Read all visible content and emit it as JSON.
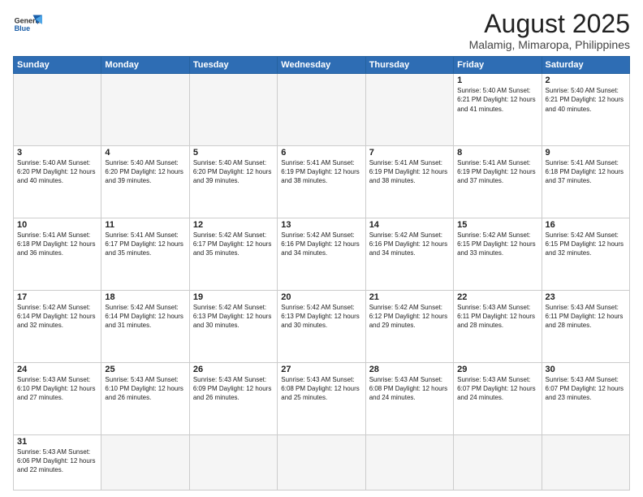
{
  "header": {
    "logo_general": "General",
    "logo_blue": "Blue",
    "title": "August 2025",
    "subtitle": "Malamig, Mimaropa, Philippines"
  },
  "weekdays": [
    "Sunday",
    "Monday",
    "Tuesday",
    "Wednesday",
    "Thursday",
    "Friday",
    "Saturday"
  ],
  "weeks": [
    [
      {
        "day": "",
        "info": ""
      },
      {
        "day": "",
        "info": ""
      },
      {
        "day": "",
        "info": ""
      },
      {
        "day": "",
        "info": ""
      },
      {
        "day": "",
        "info": ""
      },
      {
        "day": "1",
        "info": "Sunrise: 5:40 AM\nSunset: 6:21 PM\nDaylight: 12 hours\nand 41 minutes."
      },
      {
        "day": "2",
        "info": "Sunrise: 5:40 AM\nSunset: 6:21 PM\nDaylight: 12 hours\nand 40 minutes."
      }
    ],
    [
      {
        "day": "3",
        "info": "Sunrise: 5:40 AM\nSunset: 6:20 PM\nDaylight: 12 hours\nand 40 minutes."
      },
      {
        "day": "4",
        "info": "Sunrise: 5:40 AM\nSunset: 6:20 PM\nDaylight: 12 hours\nand 39 minutes."
      },
      {
        "day": "5",
        "info": "Sunrise: 5:40 AM\nSunset: 6:20 PM\nDaylight: 12 hours\nand 39 minutes."
      },
      {
        "day": "6",
        "info": "Sunrise: 5:41 AM\nSunset: 6:19 PM\nDaylight: 12 hours\nand 38 minutes."
      },
      {
        "day": "7",
        "info": "Sunrise: 5:41 AM\nSunset: 6:19 PM\nDaylight: 12 hours\nand 38 minutes."
      },
      {
        "day": "8",
        "info": "Sunrise: 5:41 AM\nSunset: 6:19 PM\nDaylight: 12 hours\nand 37 minutes."
      },
      {
        "day": "9",
        "info": "Sunrise: 5:41 AM\nSunset: 6:18 PM\nDaylight: 12 hours\nand 37 minutes."
      }
    ],
    [
      {
        "day": "10",
        "info": "Sunrise: 5:41 AM\nSunset: 6:18 PM\nDaylight: 12 hours\nand 36 minutes."
      },
      {
        "day": "11",
        "info": "Sunrise: 5:41 AM\nSunset: 6:17 PM\nDaylight: 12 hours\nand 35 minutes."
      },
      {
        "day": "12",
        "info": "Sunrise: 5:42 AM\nSunset: 6:17 PM\nDaylight: 12 hours\nand 35 minutes."
      },
      {
        "day": "13",
        "info": "Sunrise: 5:42 AM\nSunset: 6:16 PM\nDaylight: 12 hours\nand 34 minutes."
      },
      {
        "day": "14",
        "info": "Sunrise: 5:42 AM\nSunset: 6:16 PM\nDaylight: 12 hours\nand 34 minutes."
      },
      {
        "day": "15",
        "info": "Sunrise: 5:42 AM\nSunset: 6:15 PM\nDaylight: 12 hours\nand 33 minutes."
      },
      {
        "day": "16",
        "info": "Sunrise: 5:42 AM\nSunset: 6:15 PM\nDaylight: 12 hours\nand 32 minutes."
      }
    ],
    [
      {
        "day": "17",
        "info": "Sunrise: 5:42 AM\nSunset: 6:14 PM\nDaylight: 12 hours\nand 32 minutes."
      },
      {
        "day": "18",
        "info": "Sunrise: 5:42 AM\nSunset: 6:14 PM\nDaylight: 12 hours\nand 31 minutes."
      },
      {
        "day": "19",
        "info": "Sunrise: 5:42 AM\nSunset: 6:13 PM\nDaylight: 12 hours\nand 30 minutes."
      },
      {
        "day": "20",
        "info": "Sunrise: 5:42 AM\nSunset: 6:13 PM\nDaylight: 12 hours\nand 30 minutes."
      },
      {
        "day": "21",
        "info": "Sunrise: 5:42 AM\nSunset: 6:12 PM\nDaylight: 12 hours\nand 29 minutes."
      },
      {
        "day": "22",
        "info": "Sunrise: 5:43 AM\nSunset: 6:11 PM\nDaylight: 12 hours\nand 28 minutes."
      },
      {
        "day": "23",
        "info": "Sunrise: 5:43 AM\nSunset: 6:11 PM\nDaylight: 12 hours\nand 28 minutes."
      }
    ],
    [
      {
        "day": "24",
        "info": "Sunrise: 5:43 AM\nSunset: 6:10 PM\nDaylight: 12 hours\nand 27 minutes."
      },
      {
        "day": "25",
        "info": "Sunrise: 5:43 AM\nSunset: 6:10 PM\nDaylight: 12 hours\nand 26 minutes."
      },
      {
        "day": "26",
        "info": "Sunrise: 5:43 AM\nSunset: 6:09 PM\nDaylight: 12 hours\nand 26 minutes."
      },
      {
        "day": "27",
        "info": "Sunrise: 5:43 AM\nSunset: 6:08 PM\nDaylight: 12 hours\nand 25 minutes."
      },
      {
        "day": "28",
        "info": "Sunrise: 5:43 AM\nSunset: 6:08 PM\nDaylight: 12 hours\nand 24 minutes."
      },
      {
        "day": "29",
        "info": "Sunrise: 5:43 AM\nSunset: 6:07 PM\nDaylight: 12 hours\nand 24 minutes."
      },
      {
        "day": "30",
        "info": "Sunrise: 5:43 AM\nSunset: 6:07 PM\nDaylight: 12 hours\nand 23 minutes."
      }
    ],
    [
      {
        "day": "31",
        "info": "Sunrise: 5:43 AM\nSunset: 6:06 PM\nDaylight: 12 hours\nand 22 minutes."
      },
      {
        "day": "",
        "info": ""
      },
      {
        "day": "",
        "info": ""
      },
      {
        "day": "",
        "info": ""
      },
      {
        "day": "",
        "info": ""
      },
      {
        "day": "",
        "info": ""
      },
      {
        "day": "",
        "info": ""
      }
    ]
  ]
}
